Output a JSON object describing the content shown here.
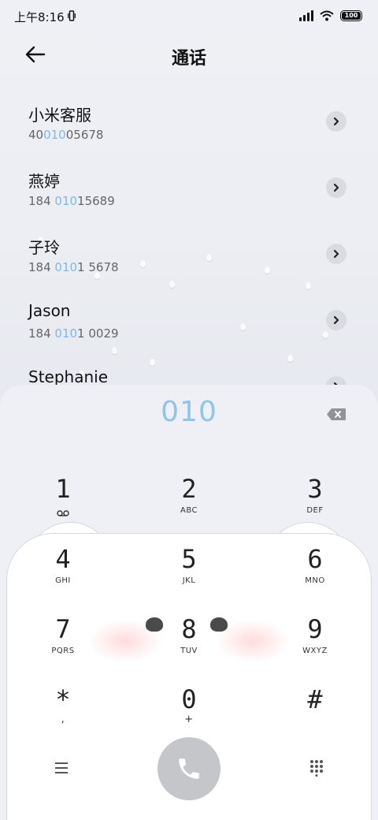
{
  "status_bar": {
    "time": "上午8:16",
    "battery": "100"
  },
  "header": {
    "title": "通话"
  },
  "contacts": [
    {
      "name": "小米客服",
      "num_pre": "40",
      "num_hl": "010",
      "num_post": "05678"
    },
    {
      "name": "燕婷",
      "num_pre": "184 ",
      "num_hl": "010",
      "num_post": "15689"
    },
    {
      "name": "子玲",
      "num_pre": "184 ",
      "num_hl": "010",
      "num_post": "1 5678"
    },
    {
      "name": "Jason",
      "num_pre": "184 ",
      "num_hl": "010",
      "num_post": "1 0029"
    },
    {
      "name": "Stephanie",
      "num_pre": "",
      "num_hl": "",
      "num_post": ""
    }
  ],
  "dialer": {
    "input": "010",
    "keys": [
      {
        "digit": "1",
        "letters": ""
      },
      {
        "digit": "2",
        "letters": "ABC"
      },
      {
        "digit": "3",
        "letters": "DEF"
      },
      {
        "digit": "4",
        "letters": "GHI"
      },
      {
        "digit": "5",
        "letters": "JKL"
      },
      {
        "digit": "6",
        "letters": "MNO"
      },
      {
        "digit": "7",
        "letters": "PQRS"
      },
      {
        "digit": "8",
        "letters": "TUV"
      },
      {
        "digit": "9",
        "letters": "WXYZ"
      },
      {
        "digit": "*",
        "letters": ","
      },
      {
        "digit": "0",
        "letters": "+"
      },
      {
        "digit": "#",
        "letters": ""
      }
    ]
  },
  "icons": {
    "back": "back-arrow-icon",
    "chevron": "chevron-right-icon",
    "delete": "backspace-icon",
    "menu": "menu-icon",
    "call": "phone-icon",
    "keypad": "dialpad-icon",
    "voicemail": "voicemail-icon"
  },
  "colors": {
    "highlight": "#7fb8e8",
    "call_button": "#c4c6ca",
    "dial_input": "#8ec3ec"
  }
}
